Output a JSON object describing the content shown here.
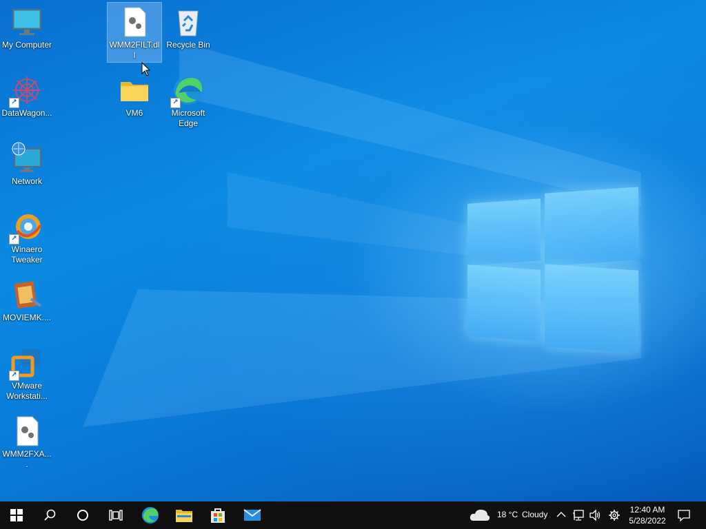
{
  "desktop": {
    "icons": [
      {
        "label": "My Computer"
      },
      {
        "label": "DataWagon..."
      },
      {
        "label": "Network"
      },
      {
        "label": "Winaero Tweaker"
      },
      {
        "label": "MOVIEMK...."
      },
      {
        "label": "VMware Workstati..."
      },
      {
        "label": "WMM2FXA...."
      },
      {
        "label": "WMM2FILT.dll"
      },
      {
        "label": "VM6"
      },
      {
        "label": "Recycle Bin"
      },
      {
        "label": "Microsoft Edge"
      }
    ],
    "selected_icon": "WMM2FILT.dll"
  },
  "taskbar": {
    "buttons": [
      "windows-start-icon",
      "search-icon",
      "cortana-icon",
      "task-view-icon",
      "edge-icon",
      "file-explorer-icon",
      "microsoft-store-icon",
      "mail-icon"
    ],
    "weather": {
      "temp": "18 °C",
      "condition": "Cloudy"
    },
    "clock": {
      "time": "12:40 AM",
      "date": "5/28/2022"
    }
  },
  "colors": {
    "accent": "#0a78d7",
    "taskbar": "#101010"
  }
}
